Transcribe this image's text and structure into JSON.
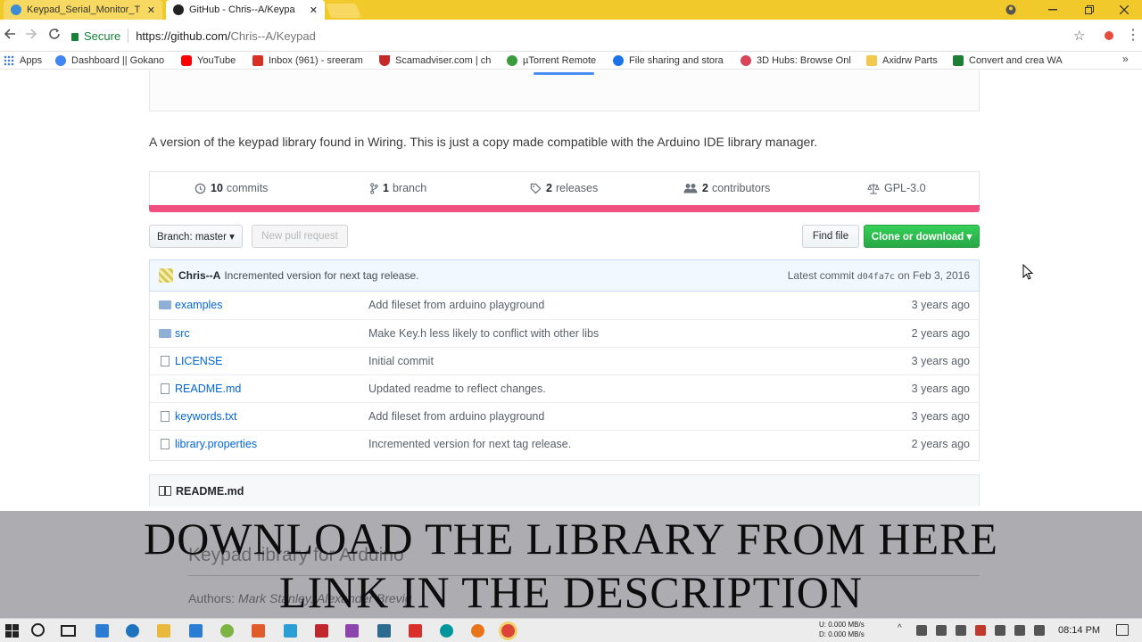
{
  "browser": {
    "tabs": [
      {
        "title": "Keypad_Serial_Monitor_T",
        "active": false,
        "close": "✕"
      },
      {
        "title": "GitHub - Chris--A/Keypa",
        "active": true,
        "close": "✕"
      }
    ],
    "address": {
      "security_label": "Secure",
      "url_host": "https://github.com/",
      "url_path": "Chris--A/Keypad"
    },
    "icons": {
      "back": "back-arrow-icon",
      "forward": "forward-arrow-icon",
      "reload": "reload-icon",
      "star": "star-icon",
      "menu": "menu-icon"
    },
    "bookmarks": [
      {
        "label": "Apps",
        "color": "#3b78e7"
      },
      {
        "label": "Dashboard || Gokano",
        "color": "#4285f4"
      },
      {
        "label": "YouTube",
        "color": "#ff0000"
      },
      {
        "label": "Inbox (961) - sreeram",
        "color": "#d93025"
      },
      {
        "label": "Scamadviser.com | ch",
        "color": "#c62828"
      },
      {
        "label": "µTorrent Remote",
        "color": "#3a9b3a"
      },
      {
        "label": "File sharing and stora",
        "color": "#1a73e8"
      },
      {
        "label": "3D Hubs: Browse Onl",
        "color": "#d9445a"
      },
      {
        "label": "Axidrw Parts",
        "color": "#f2c94c"
      },
      {
        "label": "Convert and crea WA",
        "color": "#1e7e34"
      }
    ]
  },
  "repo": {
    "description": "A version of the keypad library found in Wiring. This is just a copy made compatible with the Arduino IDE library manager.",
    "summary": [
      {
        "icon": "history-icon",
        "glyph": "◷",
        "count": "10",
        "label": "commits"
      },
      {
        "icon": "branch-icon",
        "glyph": "ᚴ",
        "count": "1",
        "label": "branch"
      },
      {
        "icon": "tag-icon",
        "glyph": "⌂",
        "count": "2",
        "label": "releases"
      },
      {
        "icon": "people-icon",
        "glyph": "👥",
        "count": "2",
        "label": "contributors"
      },
      {
        "icon": "law-icon",
        "glyph": "⚖",
        "count": "",
        "label": "GPL-3.0"
      }
    ],
    "language_color": "#f0507f",
    "branch_button": "Branch: master ▾",
    "new_pr_button": "New pull request",
    "find_file_button": "Find file",
    "clone_button": "Clone or download ▾",
    "latest_commit": {
      "author": "Chris--A",
      "message": "Incremented version for next tag release.",
      "latest_label": "Latest commit",
      "sha": "d04fa7c",
      "date": "on Feb 3, 2016"
    },
    "files": [
      {
        "type": "dir",
        "name": "examples",
        "message": "Add fileset from arduino playground",
        "age": "3 years ago"
      },
      {
        "type": "dir",
        "name": "src",
        "message": "Make Key.h less likely to conflict with other libs",
        "age": "2 years ago"
      },
      {
        "type": "file",
        "name": "LICENSE",
        "message": "Initial commit",
        "age": "3 years ago"
      },
      {
        "type": "file",
        "name": "README.md",
        "message": "Updated readme to reflect changes.",
        "age": "3 years ago"
      },
      {
        "type": "file",
        "name": "keywords.txt",
        "message": "Add fileset from arduino playground",
        "age": "3 years ago"
      },
      {
        "type": "file",
        "name": "library.properties",
        "message": "Incremented version for next tag release.",
        "age": "2 years ago"
      }
    ],
    "readme_header": "README.md",
    "readme_title": "Keypad library for Arduino",
    "readme_authors_label": "Authors:",
    "readme_authors": "Mark Stanley, Alexander Brevig"
  },
  "overlay": {
    "line1": "DOWNLOAD THE LIBRARY FROM HERE",
    "line2": "LINK IN THE DESCRIPTION"
  },
  "taskbar": {
    "net_up": "0.000 MB/s",
    "net_down": "0.000 MB/s",
    "net_up_label": "U:",
    "net_down_label": "D:",
    "time": "08:14 PM",
    "apps": [
      {
        "icon": "edge-icon",
        "color": "#1e73be"
      },
      {
        "icon": "explorer-icon",
        "color": "#e8b93a"
      },
      {
        "icon": "store-icon",
        "color": "#2b7cd3"
      },
      {
        "icon": "android-icon",
        "color": "#7cb342"
      },
      {
        "icon": "app-icon",
        "color": "#e25b2a"
      },
      {
        "icon": "telegram-icon",
        "color": "#2a9fd6"
      },
      {
        "icon": "acrobat-icon",
        "color": "#c0272d"
      },
      {
        "icon": "winrar-icon",
        "color": "#8e44ad"
      },
      {
        "icon": "tool-icon",
        "color": "#2d6a8f"
      },
      {
        "icon": "foxit-icon",
        "color": "#d9302c"
      },
      {
        "icon": "arduino-icon",
        "color": "#00979c"
      },
      {
        "icon": "firefox-icon",
        "color": "#e8751a"
      },
      {
        "icon": "chrome-icon",
        "color": "#db4437"
      }
    ]
  }
}
